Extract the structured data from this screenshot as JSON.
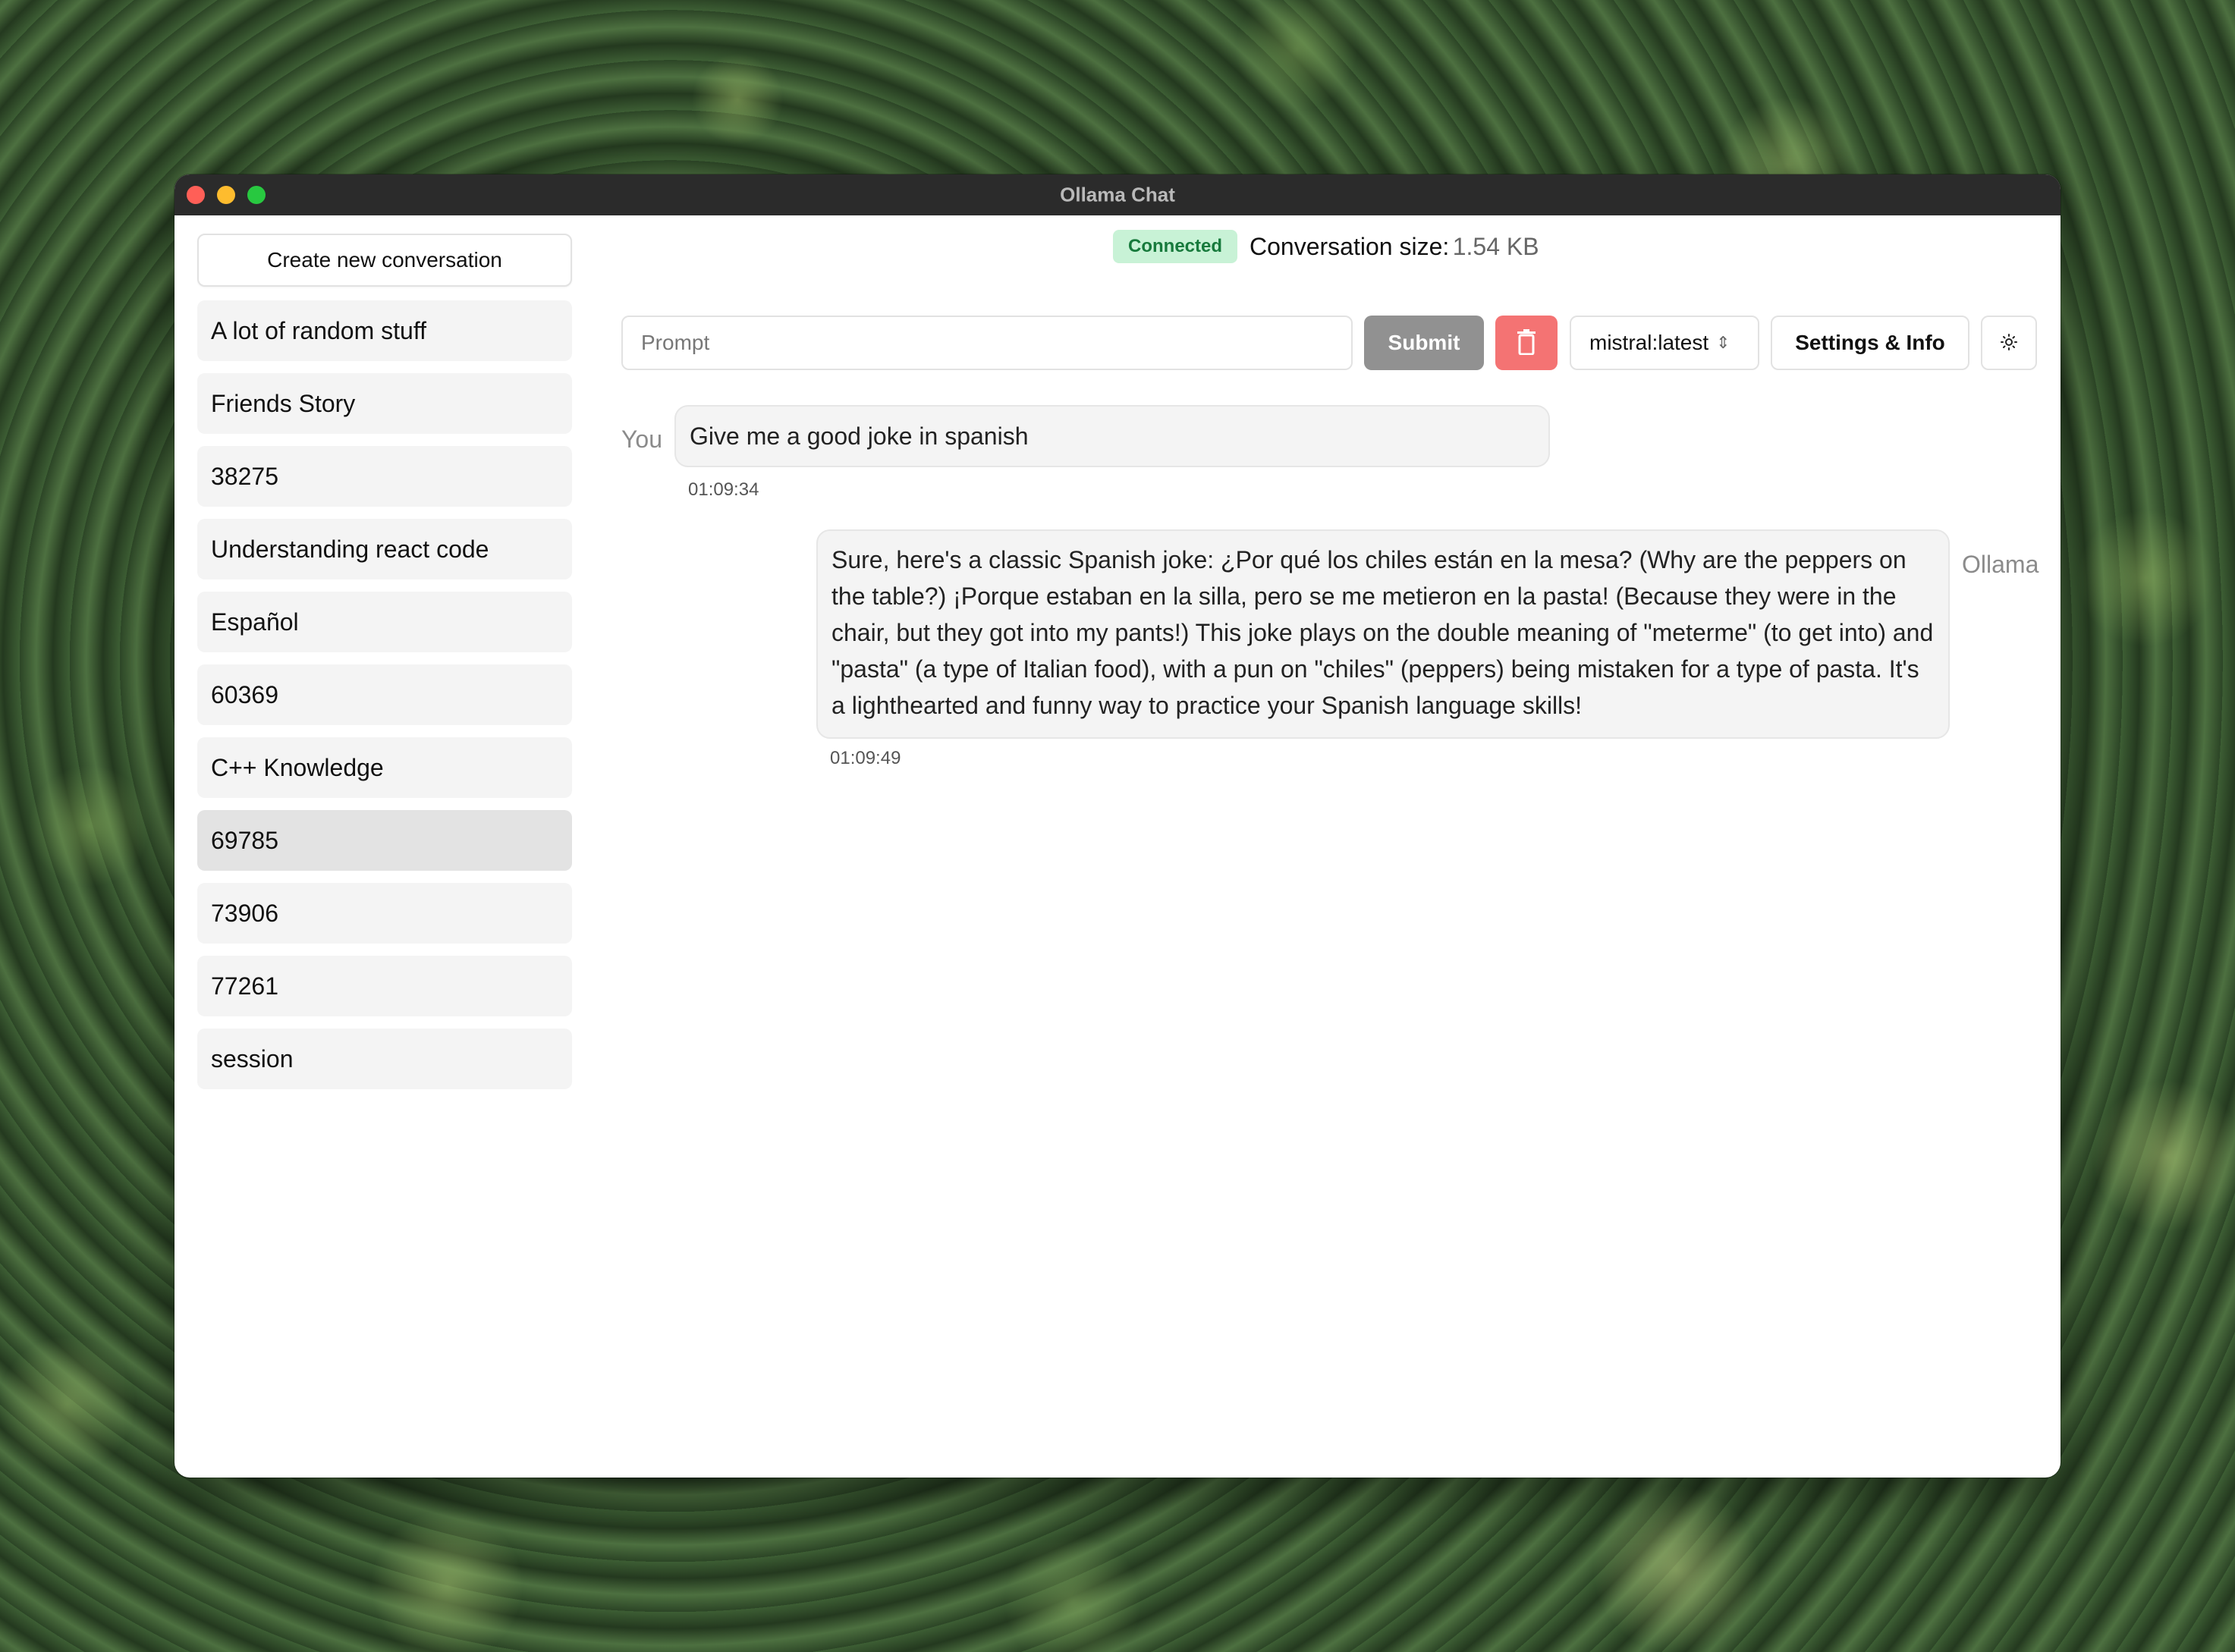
{
  "window": {
    "title": "Ollama Chat"
  },
  "sidebar": {
    "new_conversation_label": "Create new conversation",
    "items": [
      {
        "label": "A lot of random stuff",
        "active": false
      },
      {
        "label": "Friends Story",
        "active": false
      },
      {
        "label": "38275",
        "active": false
      },
      {
        "label": "Understanding react code",
        "active": false
      },
      {
        "label": "Español",
        "active": false
      },
      {
        "label": "60369",
        "active": false
      },
      {
        "label": "C++ Knowledge",
        "active": false
      },
      {
        "label": "69785",
        "active": true
      },
      {
        "label": "73906",
        "active": false
      },
      {
        "label": "77261",
        "active": false
      },
      {
        "label": "session",
        "active": false
      }
    ]
  },
  "status": {
    "connection": "Connected",
    "size_label": "Conversation size:",
    "size_value": "1.54 KB"
  },
  "toolbar": {
    "prompt_placeholder": "Prompt",
    "prompt_value": "",
    "submit_label": "Submit",
    "delete_icon": "trash-icon",
    "model_selected": "mistral:latest",
    "settings_label": "Settings & Info",
    "theme_icon": "sun-icon"
  },
  "messages": [
    {
      "sender": "You",
      "text": "Give me a good joke in spanish",
      "time": "01:09:34"
    },
    {
      "sender": "Ollama",
      "text": "Sure, here's a classic Spanish joke: ¿Por qué los chiles están en la mesa? (Why are the peppers on the table?) ¡Porque estaban en la silla, pero se me metieron en la pasta! (Because they were in the chair, but they got into my pants!) This joke plays on the double meaning of \"meterme\" (to get into) and \"pasta\" (a type of Italian food), with a pun on \"chiles\" (peppers) being mistaken for a type of pasta. It's a lighthearted and funny way to practice your Spanish language skills!",
      "time": "01:09:49"
    }
  ],
  "colors": {
    "connected_bg": "#c8f2d6",
    "connected_text": "#177a3c",
    "submit_bg": "#919191",
    "delete_bg": "#f47373",
    "titlebar_bg": "#2b2b2b"
  }
}
